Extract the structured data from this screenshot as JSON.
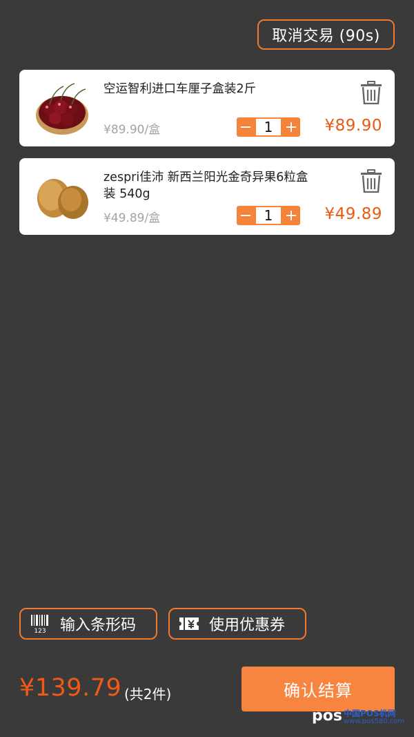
{
  "header": {
    "cancel_label": "取消交易 (90s)"
  },
  "cart": {
    "items": [
      {
        "name": "空运智利进口车厘子盒装2斤",
        "unit_price": "¥89.90/盒",
        "quantity": "1",
        "price": "¥89.90",
        "image": "cherry-image"
      },
      {
        "name": "zespri佳沛 新西兰阳光金奇异果6粒盒装 540g",
        "unit_price": "¥49.89/盒",
        "quantity": "1",
        "price": "¥49.89",
        "image": "kiwi-image"
      }
    ]
  },
  "tools": {
    "barcode_label": "输入条形码",
    "coupon_label": "使用优惠券",
    "barcode_icon_text": "123"
  },
  "footer": {
    "total": "¥139.79",
    "count": "(共2件)",
    "confirm_label": "确认结算"
  },
  "watermark": {
    "logo": "pos",
    "title": "中国POS机网",
    "url": "www.pos580.com"
  },
  "colors": {
    "accent": "#f5843a",
    "price": "#ea5a13",
    "background": "#3a3a3a"
  }
}
